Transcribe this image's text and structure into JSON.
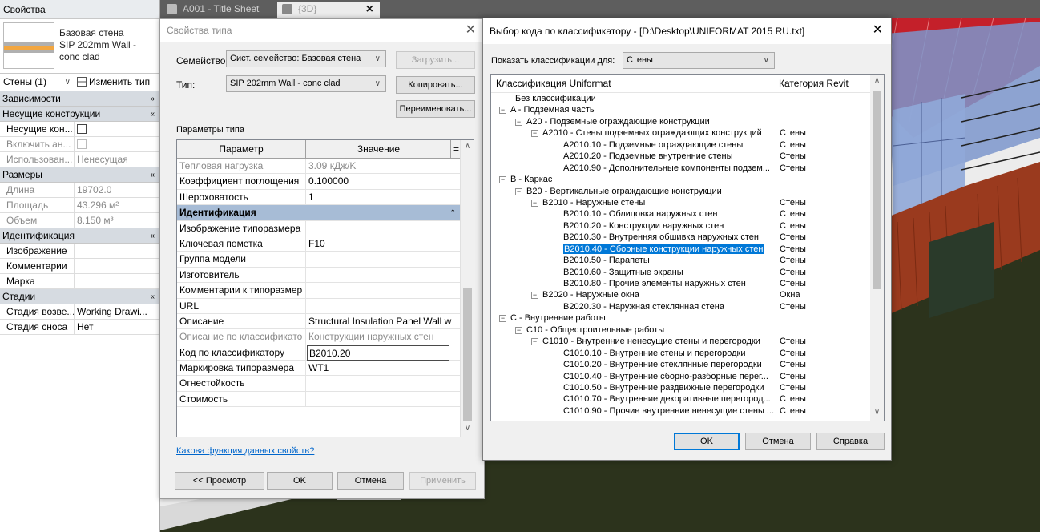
{
  "properties_panel": {
    "title": "Свойства",
    "type_name_line1": "Базовая стена",
    "type_name_line2": "SIP 202mm Wall - conc clad",
    "filter": "Стены (1)",
    "edit_type": "Изменить тип",
    "categories": [
      {
        "name": "Зависимости"
      },
      {
        "name": "Несущие конструкции"
      },
      {
        "name": "Размеры"
      },
      {
        "name": "Идентификация"
      },
      {
        "name": "Стадии"
      }
    ],
    "rows": {
      "structural": {
        "label": "Несущие кон...",
        "value": ""
      },
      "enable_analytical": {
        "label": "Включить ан...",
        "value": ""
      },
      "structural_usage": {
        "label": "Использован...",
        "value": "Ненесущая"
      },
      "length": {
        "label": "Длина",
        "value": "19702.0"
      },
      "area": {
        "label": "Площадь",
        "value": "43.296 м²"
      },
      "volume": {
        "label": "Объем",
        "value": "8.150 м³"
      },
      "image": {
        "label": "Изображение",
        "value": ""
      },
      "comments": {
        "label": "Комментарии",
        "value": ""
      },
      "mark": {
        "label": "Марка",
        "value": ""
      },
      "phase_created": {
        "label": "Стадия возве...",
        "value": "Working Drawi..."
      },
      "phase_demolished": {
        "label": "Стадия сноса",
        "value": "Нет"
      }
    }
  },
  "tabs": [
    {
      "label": "A001 - Title Sheet"
    },
    {
      "label": "{3D}"
    }
  ],
  "type_properties": {
    "title": "Свойства типа",
    "family_label": "Семейство:",
    "family_value": "Сист. семейство: Базовая стена",
    "type_label": "Тип:",
    "type_value": "SIP 202mm Wall - conc clad",
    "load_button": "Загрузить...",
    "copy_button": "Копировать...",
    "rename_button": "Переименовать...",
    "params_label": "Параметры типа",
    "col_param": "Параметр",
    "col_value": "Значение",
    "col_eq": "=",
    "rows": [
      {
        "k": "Тепловая нагрузка",
        "v": "3.09 кДж/K",
        "ro": true
      },
      {
        "k": "Коэффициент поглощения",
        "v": "0.100000"
      },
      {
        "k": "Шероховатость",
        "v": "1"
      },
      {
        "group": "Идентификация"
      },
      {
        "k": "Изображение типоразмера",
        "v": ""
      },
      {
        "k": "Ключевая пометка",
        "v": "F10"
      },
      {
        "k": "Группа модели",
        "v": ""
      },
      {
        "k": "Изготовитель",
        "v": ""
      },
      {
        "k": "Комментарии к типоразмер",
        "v": ""
      },
      {
        "k": "URL",
        "v": ""
      },
      {
        "k": "Описание",
        "v": "Structural Insulation Panel Wall w"
      },
      {
        "k": "Описание по классификато",
        "v": "Конструкции наружных стен",
        "ro": true
      },
      {
        "k": "Код по классификатору",
        "v": "B2010.20",
        "edit": true
      },
      {
        "k": "Маркировка типоразмера",
        "v": "WT1"
      },
      {
        "k": "Огнестойкость",
        "v": ""
      },
      {
        "k": "Стоимость",
        "v": ""
      }
    ],
    "help_link": "Какова функция данных свойств?",
    "preview_button": "<< Просмотр",
    "ok_button": "OK",
    "cancel_button": "Отмена",
    "apply_button": "Применить"
  },
  "classification": {
    "title": "Выбор кода по классификатору - [D:\\Desktop\\UNIFORMAT 2015 RU.txt]",
    "show_label": "Показать классификации для:",
    "show_value": "Стены",
    "col_uniformat": "Классификация Uniformat",
    "col_category": "Категория Revit",
    "tree": [
      {
        "lvl": 0,
        "exp": false,
        "name": "Без классификации",
        "cat": ""
      },
      {
        "lvl": 0,
        "exp": true,
        "name": "A - Подземная часть",
        "cat": ""
      },
      {
        "lvl": 1,
        "exp": true,
        "name": "A20 - Подземные ограждающие конструкции",
        "cat": ""
      },
      {
        "lvl": 2,
        "exp": true,
        "name": "A2010 - Стены подземных ограждающих конструкций",
        "cat": "Стены"
      },
      {
        "lvl": 3,
        "exp": false,
        "name": "A2010.10 - Подземные ограждающие стены",
        "cat": "Стены"
      },
      {
        "lvl": 3,
        "exp": false,
        "name": "A2010.20 - Подземные внутренние стены",
        "cat": "Стены"
      },
      {
        "lvl": 3,
        "exp": false,
        "name": "A2010.90 - Дополнительные компоненты подзем...",
        "cat": "Стены"
      },
      {
        "lvl": 0,
        "exp": true,
        "name": "B - Каркас",
        "cat": ""
      },
      {
        "lvl": 1,
        "exp": true,
        "name": "B20 - Вертикальные ограждающие конструкции",
        "cat": ""
      },
      {
        "lvl": 2,
        "exp": true,
        "name": "B2010 - Наружные стены",
        "cat": "Стены"
      },
      {
        "lvl": 3,
        "exp": false,
        "name": "B2010.10 - Облицовка наружных стен",
        "cat": "Стены"
      },
      {
        "lvl": 3,
        "exp": false,
        "name": "B2010.20 - Конструкции наружных стен",
        "cat": "Стены"
      },
      {
        "lvl": 3,
        "exp": false,
        "name": "B2010.30 - Внутренняя обшивка наружных стен",
        "cat": "Стены"
      },
      {
        "lvl": 3,
        "exp": false,
        "name": "B2010.40 - Сборные конструкции наружных стен",
        "cat": "Стены",
        "sel": true
      },
      {
        "lvl": 3,
        "exp": false,
        "name": "B2010.50 - Парапеты",
        "cat": "Стены"
      },
      {
        "lvl": 3,
        "exp": false,
        "name": "B2010.60 - Защитные экраны",
        "cat": "Стены"
      },
      {
        "lvl": 3,
        "exp": false,
        "name": "B2010.80 - Прочие элементы наружных стен",
        "cat": "Стены"
      },
      {
        "lvl": 2,
        "exp": true,
        "name": "B2020 - Наружные окна",
        "cat": "Окна"
      },
      {
        "lvl": 3,
        "exp": false,
        "name": "B2020.30 - Наружная стеклянная стена",
        "cat": "Стены"
      },
      {
        "lvl": 0,
        "exp": true,
        "name": "C - Внутренние работы",
        "cat": ""
      },
      {
        "lvl": 1,
        "exp": true,
        "name": "C10 - Общестроительные работы",
        "cat": ""
      },
      {
        "lvl": 2,
        "exp": true,
        "name": "C1010 - Внутренние ненесущие стены и перегородки",
        "cat": "Стены"
      },
      {
        "lvl": 3,
        "exp": false,
        "name": "C1010.10 - Внутренние стены и перегородки",
        "cat": "Стены"
      },
      {
        "lvl": 3,
        "exp": false,
        "name": "C1010.20 - Внутренние стеклянные перегородки",
        "cat": "Стены"
      },
      {
        "lvl": 3,
        "exp": false,
        "name": "C1010.40 - Внутренние сборно-разборные перег...",
        "cat": "Стены"
      },
      {
        "lvl": 3,
        "exp": false,
        "name": "C1010.50 - Внутренние раздвижные перегородки",
        "cat": "Стены"
      },
      {
        "lvl": 3,
        "exp": false,
        "name": "C1010.70 - Внутренние декоративные перегород...",
        "cat": "Стены"
      },
      {
        "lvl": 3,
        "exp": false,
        "name": "C1010.90 - Прочие внутренние ненесущие стены ...",
        "cat": "Стены"
      }
    ],
    "ok_button": "OK",
    "cancel_button": "Отмена",
    "help_button": "Справка"
  }
}
